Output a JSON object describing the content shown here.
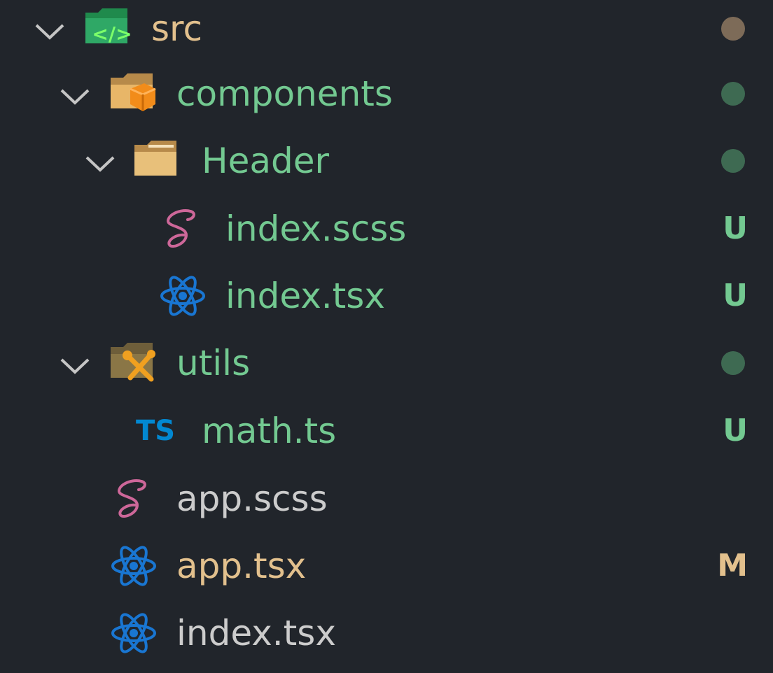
{
  "colors": {
    "background": "#21252b",
    "untracked_green": "#73c991",
    "modified_tan": "#e2c08d",
    "plain_text": "#cccccc",
    "dot_brown": "#7d6b58",
    "dot_green": "#3e6a52",
    "react_blue": "#1976d2",
    "sass_pink": "#cd6799",
    "ts_blue": "#0288d1"
  },
  "tree": {
    "src": {
      "label": "src",
      "icon": "folder-src-icon",
      "status_dot": "modified"
    },
    "components": {
      "label": "components",
      "icon": "folder-components-icon",
      "status_dot": "untracked"
    },
    "header": {
      "label": "Header",
      "icon": "folder-icon",
      "status_dot": "untracked"
    },
    "header_index_scss": {
      "label": "index.scss",
      "icon": "sass-icon",
      "status": "U"
    },
    "header_index_tsx": {
      "label": "index.tsx",
      "icon": "react-icon",
      "status": "U"
    },
    "utils": {
      "label": "utils",
      "icon": "folder-utils-icon",
      "status_dot": "untracked"
    },
    "math_ts": {
      "label": "math.ts",
      "icon": "typescript-icon",
      "badge": "TS",
      "status": "U"
    },
    "app_scss": {
      "label": "app.scss",
      "icon": "sass-icon"
    },
    "app_tsx": {
      "label": "app.tsx",
      "icon": "react-icon",
      "status": "M"
    },
    "index_tsx": {
      "label": "index.tsx",
      "icon": "react-icon"
    }
  }
}
